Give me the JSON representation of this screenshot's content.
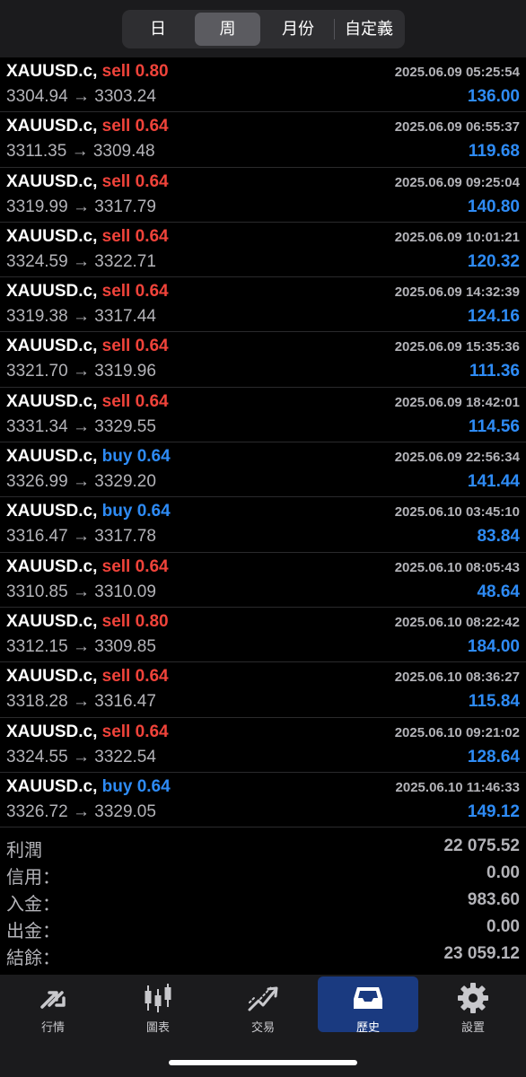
{
  "periods": {
    "items": [
      {
        "label": "日",
        "active": false
      },
      {
        "label": "周",
        "active": true
      },
      {
        "label": "月份",
        "active": false
      },
      {
        "label": "自定義",
        "active": false
      }
    ]
  },
  "deals": [
    {
      "symbol": "XAUUSD.c,",
      "direction": "sell",
      "volume": "0.80",
      "time": "2025.06.09 05:25:54",
      "open": "3304.94",
      "close": "3303.24",
      "profit": "136.00"
    },
    {
      "symbol": "XAUUSD.c,",
      "direction": "sell",
      "volume": "0.64",
      "time": "2025.06.09 06:55:37",
      "open": "3311.35",
      "close": "3309.48",
      "profit": "119.68"
    },
    {
      "symbol": "XAUUSD.c,",
      "direction": "sell",
      "volume": "0.64",
      "time": "2025.06.09 09:25:04",
      "open": "3319.99",
      "close": "3317.79",
      "profit": "140.80"
    },
    {
      "symbol": "XAUUSD.c,",
      "direction": "sell",
      "volume": "0.64",
      "time": "2025.06.09 10:01:21",
      "open": "3324.59",
      "close": "3322.71",
      "profit": "120.32"
    },
    {
      "symbol": "XAUUSD.c,",
      "direction": "sell",
      "volume": "0.64",
      "time": "2025.06.09 14:32:39",
      "open": "3319.38",
      "close": "3317.44",
      "profit": "124.16"
    },
    {
      "symbol": "XAUUSD.c,",
      "direction": "sell",
      "volume": "0.64",
      "time": "2025.06.09 15:35:36",
      "open": "3321.70",
      "close": "3319.96",
      "profit": "111.36"
    },
    {
      "symbol": "XAUUSD.c,",
      "direction": "sell",
      "volume": "0.64",
      "time": "2025.06.09 18:42:01",
      "open": "3331.34",
      "close": "3329.55",
      "profit": "114.56"
    },
    {
      "symbol": "XAUUSD.c,",
      "direction": "buy",
      "volume": "0.64",
      "time": "2025.06.09 22:56:34",
      "open": "3326.99",
      "close": "3329.20",
      "profit": "141.44"
    },
    {
      "symbol": "XAUUSD.c,",
      "direction": "buy",
      "volume": "0.64",
      "time": "2025.06.10 03:45:10",
      "open": "3316.47",
      "close": "3317.78",
      "profit": "83.84"
    },
    {
      "symbol": "XAUUSD.c,",
      "direction": "sell",
      "volume": "0.64",
      "time": "2025.06.10 08:05:43",
      "open": "3310.85",
      "close": "3310.09",
      "profit": "48.64"
    },
    {
      "symbol": "XAUUSD.c,",
      "direction": "sell",
      "volume": "0.80",
      "time": "2025.06.10 08:22:42",
      "open": "3312.15",
      "close": "3309.85",
      "profit": "184.00"
    },
    {
      "symbol": "XAUUSD.c,",
      "direction": "sell",
      "volume": "0.64",
      "time": "2025.06.10 08:36:27",
      "open": "3318.28",
      "close": "3316.47",
      "profit": "115.84"
    },
    {
      "symbol": "XAUUSD.c,",
      "direction": "sell",
      "volume": "0.64",
      "time": "2025.06.10 09:21:02",
      "open": "3324.55",
      "close": "3322.54",
      "profit": "128.64"
    },
    {
      "symbol": "XAUUSD.c,",
      "direction": "buy",
      "volume": "0.64",
      "time": "2025.06.10 11:46:33",
      "open": "3326.72",
      "close": "3329.05",
      "profit": "149.12"
    }
  ],
  "arrow": "→",
  "summary": {
    "profit": {
      "label": "利潤",
      "value": "22 075.52"
    },
    "credit": {
      "label": "信用：",
      "value": "0.00"
    },
    "deposit": {
      "label": "入金：",
      "value": "983.60"
    },
    "withdrawal": {
      "label": "出金：",
      "value": "0.00"
    },
    "balance": {
      "label": "結餘：",
      "value": "23 059.12"
    }
  },
  "tabs": [
    {
      "label": "行情",
      "icon": "quotes-arrows-icon",
      "active": false
    },
    {
      "label": "圖表",
      "icon": "candlestick-chart-icon",
      "active": false
    },
    {
      "label": "交易",
      "icon": "trade-trend-icon",
      "active": false
    },
    {
      "label": "歷史",
      "icon": "history-inbox-icon",
      "active": true
    },
    {
      "label": "設置",
      "icon": "settings-gear-icon",
      "active": false
    }
  ],
  "colors": {
    "sell": "#f0433a",
    "buy": "#2e8bf5",
    "profit": "#2e8bf5",
    "active_tab": "#1a3a80"
  }
}
